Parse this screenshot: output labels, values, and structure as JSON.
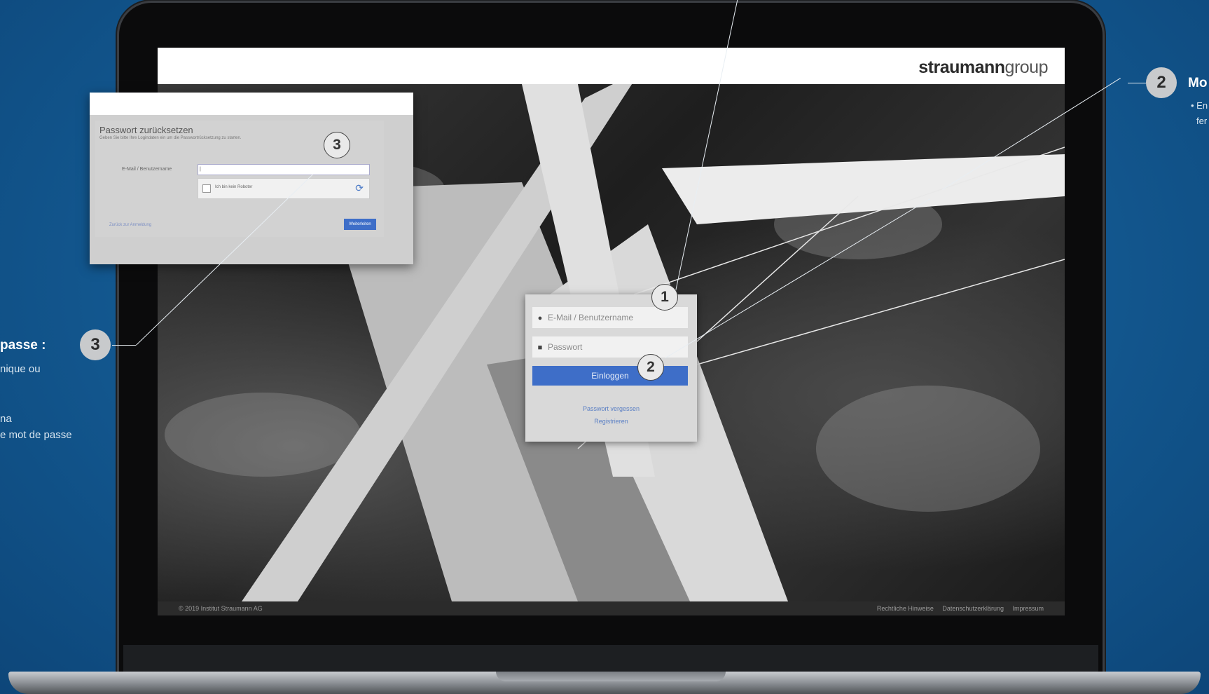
{
  "brand": {
    "name_bold": "straumann",
    "name_light": "group"
  },
  "login": {
    "email_placeholder": "E-Mail / Benutzername",
    "password_placeholder": "Passwort",
    "login_button": "Einloggen",
    "forgot_link": "Passwort vergessen",
    "register_link": "Registrieren"
  },
  "reset_panel": {
    "title": "Passwort zurücksetzen",
    "subtitle": "Geben Sie bitte Ihre Logindaten ein um die Passwortrücksetzung zu starten.",
    "field_label": "E-Mail / Benutzername",
    "field_value": "|",
    "captcha_label": "Ich bin kein Roboter",
    "back_link": "Zurück zur Anmeldung",
    "submit_button": "Weiterleiten"
  },
  "footer": {
    "copyright": "© 2019 Institut Straumann AG",
    "links": [
      "Rechtliche Hinweise",
      "Datenschutzerklärung",
      "Impressum"
    ]
  },
  "callouts": {
    "one": "1",
    "two": "2",
    "three": "3"
  },
  "annotations": {
    "left_title": "passe :",
    "left_line1": "nique ou",
    "left_line2": "na",
    "left_line3": "e mot de passe",
    "right_title": "Mo",
    "right_line1": "• En",
    "right_line2": "fer"
  },
  "colors": {
    "background": "#145c95",
    "accent_button": "#3e6ec8"
  }
}
